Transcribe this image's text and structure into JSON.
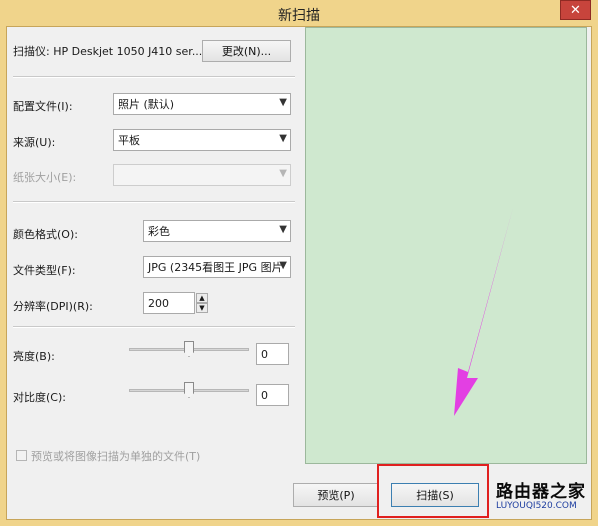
{
  "window": {
    "title": "新扫描",
    "close_glyph": "✕"
  },
  "scanner": {
    "label": "扫描仪: HP Deskjet 1050 J410 ser...",
    "change_button": "更改(N)..."
  },
  "profile": {
    "label": "配置文件(I):",
    "value": "照片 (默认)"
  },
  "source": {
    "label": "来源(U):",
    "value": "平板"
  },
  "paper_size": {
    "label": "纸张大小(E):",
    "value": ""
  },
  "color_format": {
    "label": "颜色格式(O):",
    "value": "彩色"
  },
  "file_type": {
    "label": "文件类型(F):",
    "value": "JPG (2345看图王 JPG 图片"
  },
  "resolution": {
    "label": "分辨率(DPI)(R):",
    "value": "200"
  },
  "brightness": {
    "label": "亮度(B):",
    "value": "0",
    "level": 0.5
  },
  "contrast": {
    "label": "对比度(C):",
    "value": "0",
    "level": 0.5
  },
  "separate_files": {
    "label": "预览或将图像扫描为单独的文件(T)",
    "checked": false
  },
  "buttons": {
    "preview": "预览(P)",
    "scan": "扫描(S)"
  },
  "watermark": {
    "line1": "路由器之家",
    "line2": "LUYOUQI520.COM"
  },
  "colors": {
    "title_bar": "#f0d48b",
    "preview_area": "#cfe8cf",
    "arrow": "#e33fe3",
    "highlight": "#e0201f",
    "close_button": "#c7443c"
  },
  "icons": [
    "close-icon",
    "dropdown-arrow-icon",
    "spin-up-icon",
    "spin-down-icon",
    "pointer-arrow-annotation"
  ]
}
